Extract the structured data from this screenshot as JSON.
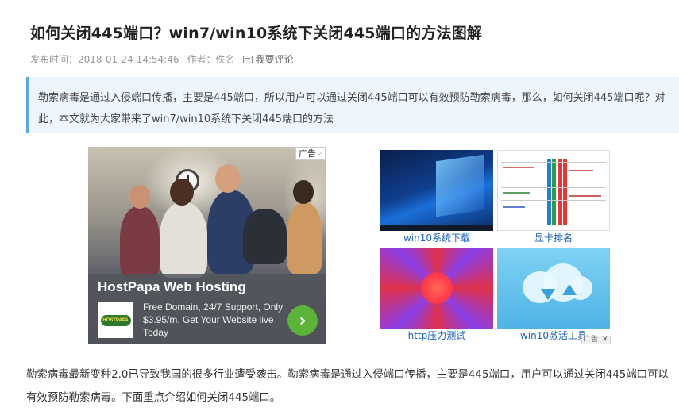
{
  "article": {
    "title": "如何关闭445端口？win7/win10系统下关闭445端口的方法图解",
    "meta": {
      "publish_label": "发布时间：",
      "publish_time": "2018-01-24 14:54:46",
      "author_label": "作者：",
      "author": "佚名",
      "comment_link": "我要评论"
    },
    "summary": "勒索病毒是通过入侵端口传播，主要是445端口，所以用户可以通过关闭445端口可以有效预防勒索病毒，那么，如何关闭445端口呢？对此，本文就为大家带来了win7/win10系统下关闭445端口的方法",
    "body": "勒索病毒最新变种2.0已导致我国的很多行业遭受袭击。勒索病毒是通过入侵端口传播，主要是445端口，用户可以通过关闭445端口可以有效预防勒索病毒。下面重点介绍如何关闭445端口。"
  },
  "ad_banner": {
    "tag_label": "广告",
    "headline": "HostPapa Web Hosting",
    "logo_text": "HOSTPAPA",
    "description": "Free Domain, 24/7 Support, Only $3.95/m. Get Your Website live Today",
    "go_icon": "chevron-right-icon",
    "accent_color": "#5bb33a"
  },
  "related": {
    "items": [
      {
        "label": "win10系统下载"
      },
      {
        "label": "显卡排名"
      },
      {
        "label": "http压力测试"
      },
      {
        "label": "win10激活工具"
      }
    ],
    "ad_tag": "广告",
    "close_glyph": "✕"
  },
  "colors": {
    "summary_border": "#5ba8de",
    "summary_bg": "#eef6fd",
    "link": "#1c63b7"
  }
}
